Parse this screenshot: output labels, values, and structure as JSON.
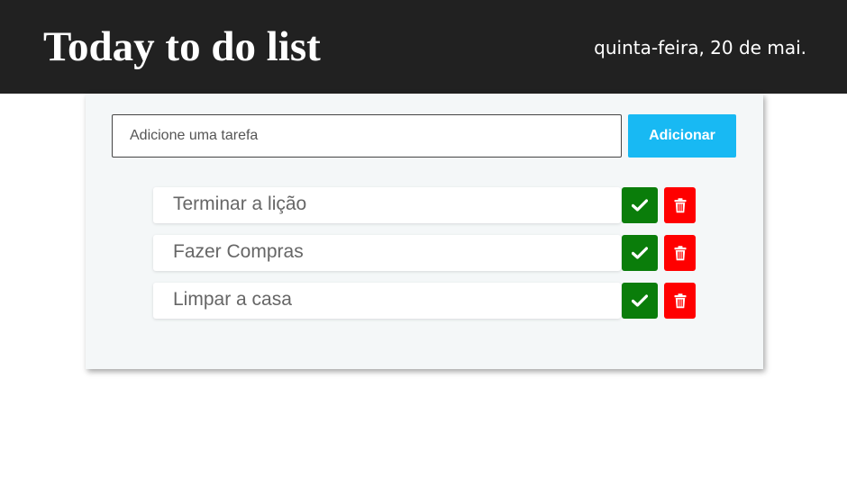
{
  "header": {
    "title": "Today to do list",
    "date": "quinta-feira, 20 de mai."
  },
  "form": {
    "input_placeholder": "Adicione uma tarefa",
    "input_value": "",
    "add_label": "Adicionar"
  },
  "tasks": [
    {
      "label": "Terminar a lição",
      "done_icon": "check-icon",
      "delete_icon": "trash-icon"
    },
    {
      "label": "Fazer Compras",
      "done_icon": "check-icon",
      "delete_icon": "trash-icon"
    },
    {
      "label": "Limpar a casa",
      "done_icon": "check-icon",
      "delete_icon": "trash-icon"
    }
  ],
  "colors": {
    "header_bg": "#212121",
    "accent": "#18b9f3",
    "done": "#0a7d0a",
    "delete": "#ff0000",
    "card_bg": "#f4f7f8"
  }
}
